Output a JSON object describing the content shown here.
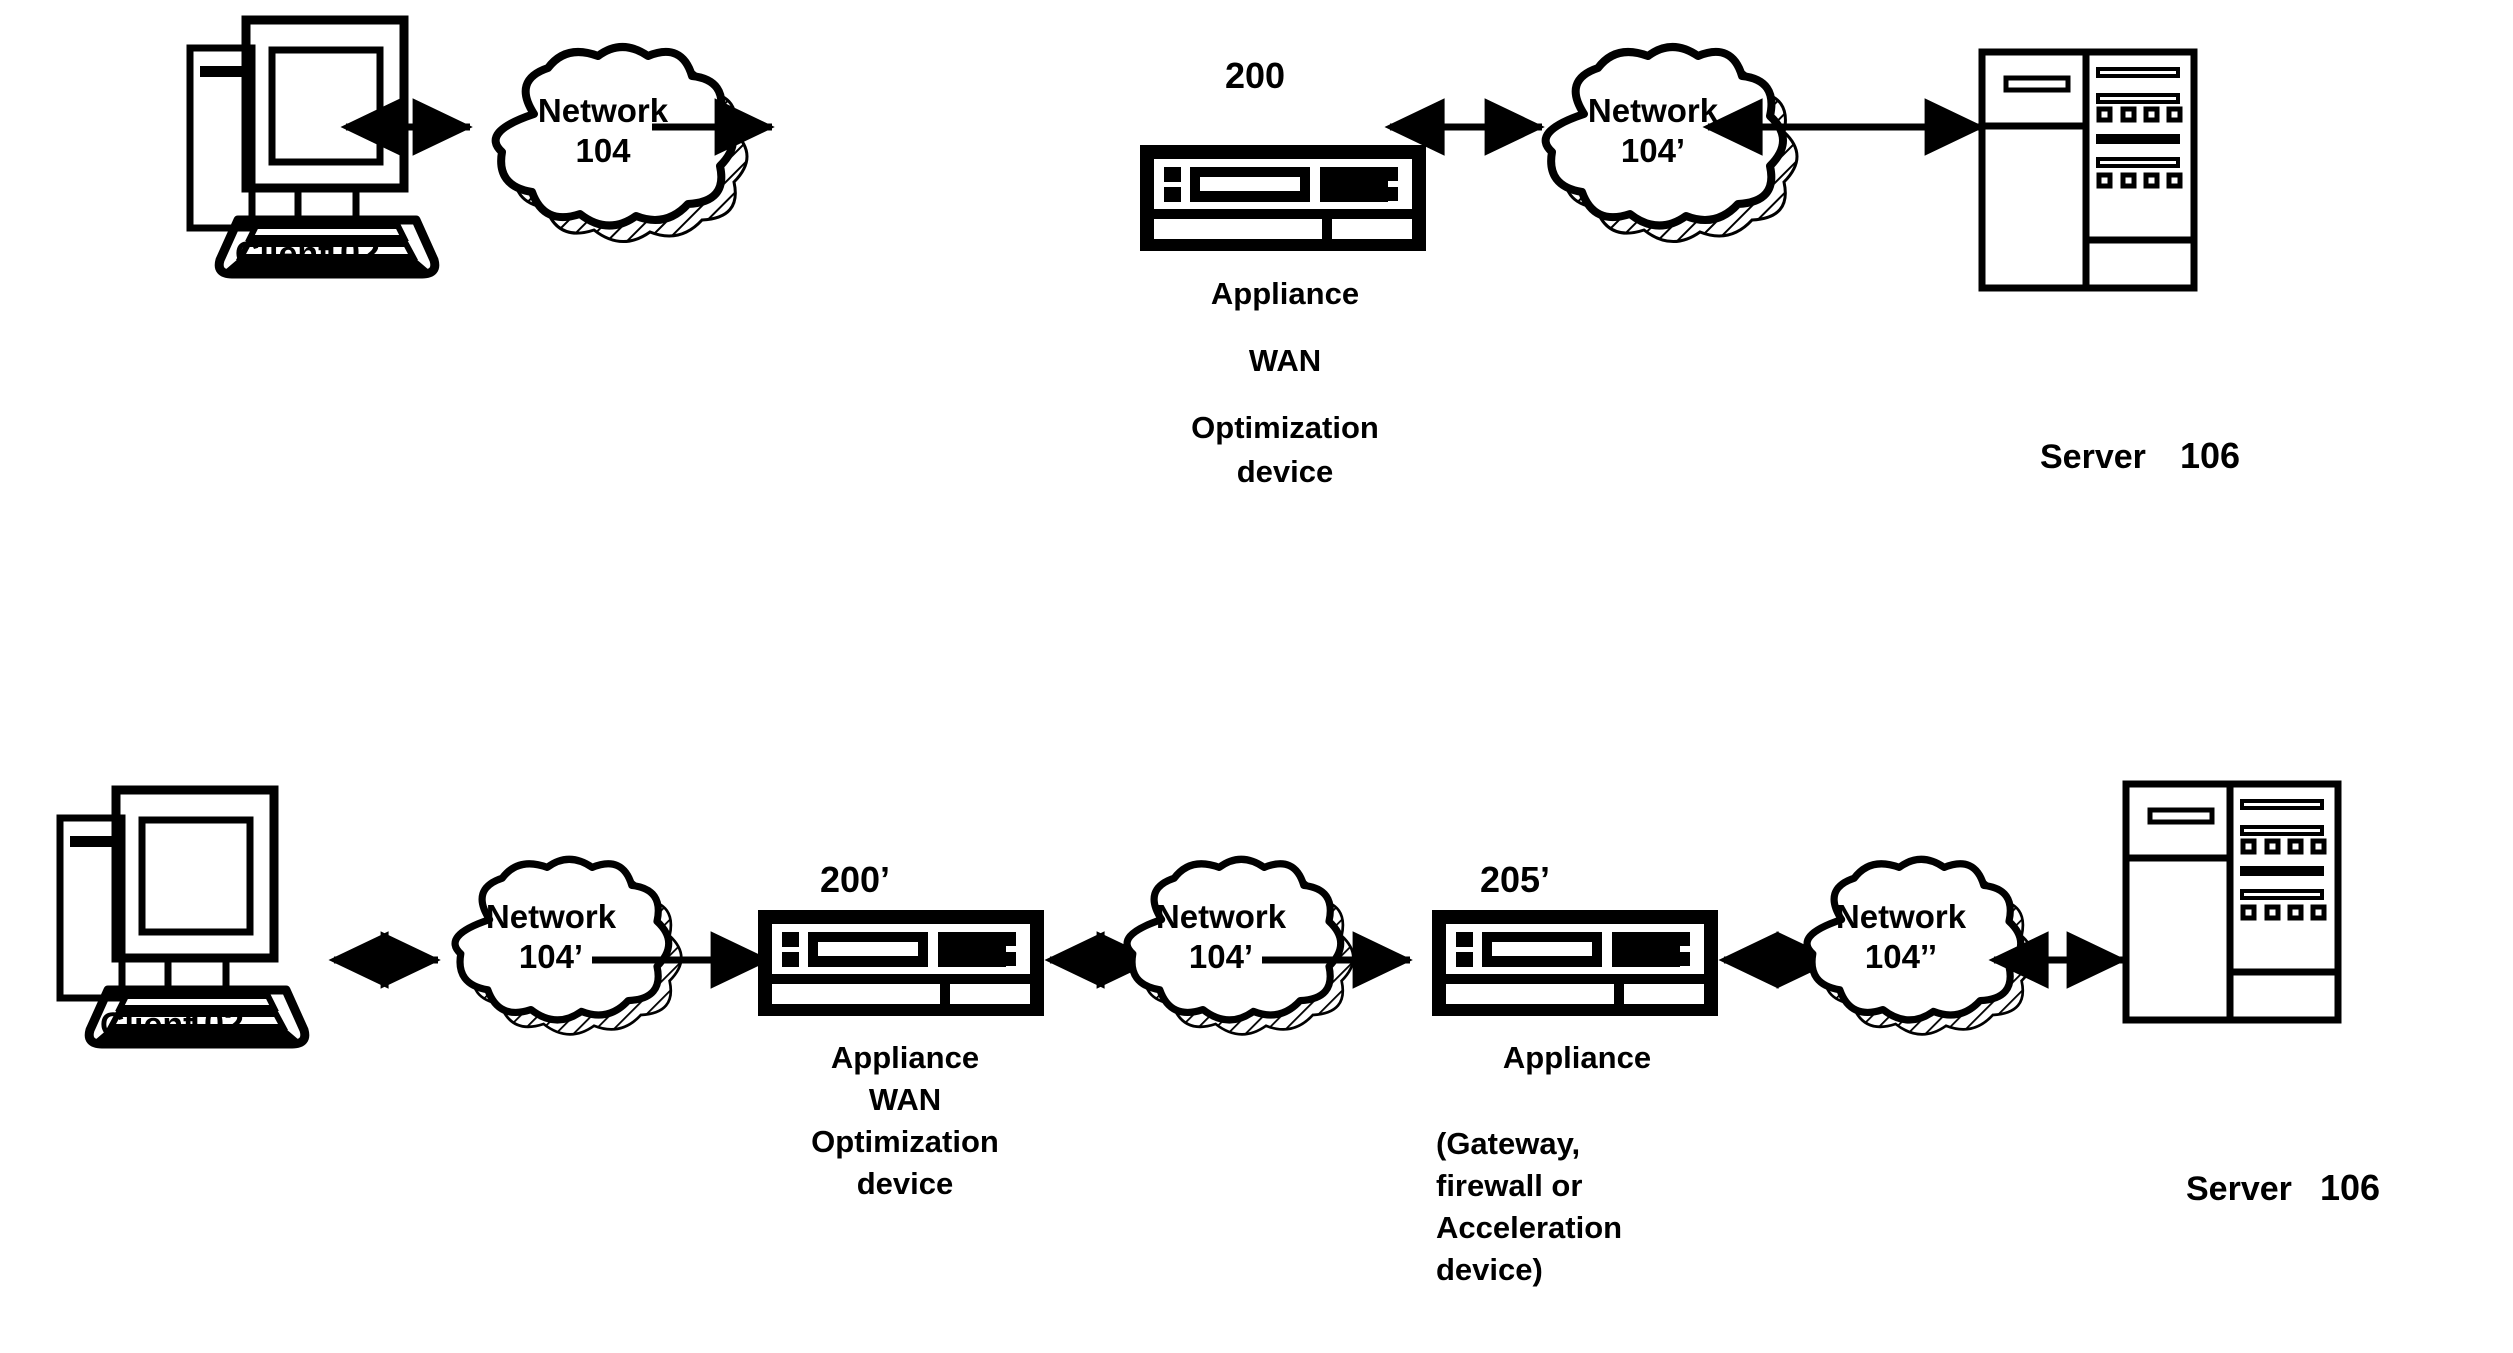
{
  "figure": {
    "kind": "patent-network-diagram",
    "background_color": "#ffffff",
    "line_color": "#000000",
    "panels": [
      {
        "id": "top",
        "nodes": [
          {
            "role": "client",
            "icon": "desktop-computer-icon",
            "label": "Client",
            "ref": "102"
          },
          {
            "role": "network",
            "icon": "cloud-icon",
            "label": "Network",
            "ref": "104"
          },
          {
            "role": "appliance",
            "icon": "appliance-icon",
            "ref": "200",
            "desc_lines": [
              "Appliance",
              "WAN",
              "Optimization",
              "device"
            ]
          },
          {
            "role": "network",
            "icon": "cloud-icon",
            "label": "Network",
            "ref": "104’"
          },
          {
            "role": "server",
            "icon": "server-rack-icon",
            "label": "Server",
            "ref": "106"
          }
        ]
      },
      {
        "id": "bottom",
        "nodes": [
          {
            "role": "client",
            "icon": "desktop-computer-icon",
            "label": "Client",
            "ref": "102"
          },
          {
            "role": "network",
            "icon": "cloud-icon",
            "label": "Network",
            "ref": "104’"
          },
          {
            "role": "appliance",
            "icon": "appliance-icon",
            "ref": "200’",
            "desc_lines": [
              "Appliance",
              "WAN",
              "Optimization",
              "device"
            ]
          },
          {
            "role": "network",
            "icon": "cloud-icon",
            "label": "Network",
            "ref": "104’"
          },
          {
            "role": "appliance",
            "icon": "appliance-icon",
            "ref": "205’",
            "desc_lines": [
              "Appliance",
              "(Gateway,",
              "firewall or",
              "Acceleration",
              "device)"
            ]
          },
          {
            "role": "network",
            "icon": "cloud-icon",
            "label": "Network",
            "ref": "104’’"
          },
          {
            "role": "server",
            "icon": "server-rack-icon",
            "label": "Server",
            "ref": "106"
          }
        ]
      }
    ]
  },
  "top": {
    "client": {
      "name": "Client",
      "ref": "102"
    },
    "net_left": {
      "name": "Network",
      "ref": "104"
    },
    "appliance": {
      "num": "200",
      "line1": "Appliance",
      "line2": "WAN",
      "line3": "Optimization",
      "line4": "device"
    },
    "net_right": {
      "name": "Network",
      "ref": "104’"
    },
    "server": {
      "name": "Server",
      "ref": "106"
    }
  },
  "bottom": {
    "client": {
      "name": "Client",
      "ref": "102"
    },
    "net1": {
      "name": "Network",
      "ref": "104’"
    },
    "appliance1": {
      "num": "200’",
      "line1": "Appliance",
      "line2": "WAN",
      "line3": "Optimization",
      "line4": "device"
    },
    "net2": {
      "name": "Network",
      "ref": "104’"
    },
    "appliance2": {
      "num": "205’",
      "line1": "Appliance",
      "line2": "(Gateway,",
      "line3": "firewall or",
      "line4": "Acceleration",
      "line5": "device)"
    },
    "net3": {
      "name": "Network",
      "ref": "104’’"
    },
    "server": {
      "name": "Server",
      "ref": "106"
    }
  },
  "icons": {
    "client": "desktop-computer-icon",
    "cloud": "cloud-icon",
    "appliance": "appliance-icon",
    "server": "server-rack-icon",
    "arrow_bidirectional": "double-arrow-icon",
    "arrow_right": "arrow-right-icon",
    "arrow_left": "arrow-left-icon"
  }
}
